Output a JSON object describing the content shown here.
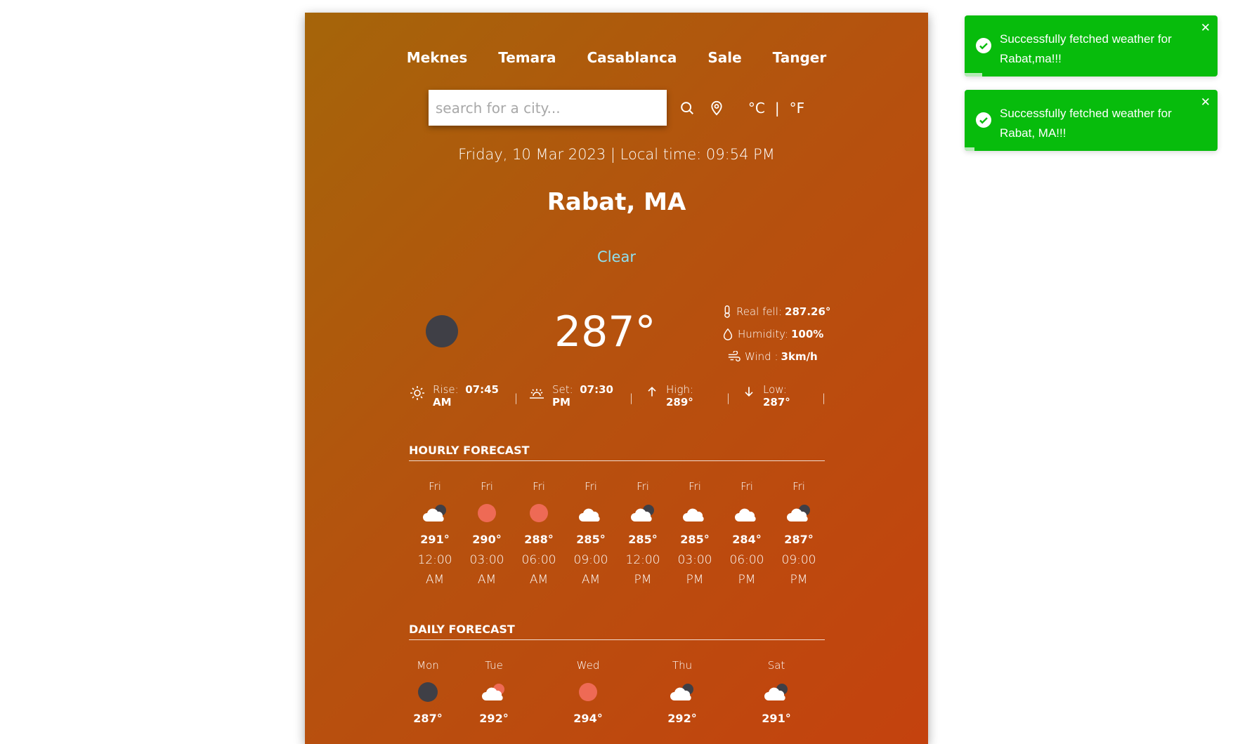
{
  "nav": {
    "cities": [
      "Meknes",
      "Temara",
      "Casablanca",
      "Sale",
      "Tanger"
    ]
  },
  "search": {
    "placeholder": "search for a city...",
    "value": ""
  },
  "units": {
    "celsius": "°C",
    "separator": "|",
    "fahrenheit": "°F"
  },
  "header": {
    "datetime": "Friday, 10 Mar 2023 | Local time: 09:54 PM",
    "city": "Rabat, MA",
    "condition": "Clear"
  },
  "current": {
    "temperature": "287°",
    "icon": "night-clear-icon",
    "real_feel_label": "Real fell:",
    "real_feel_value": "287.26°",
    "humidity_label": "Humidity:",
    "humidity_value": "100%",
    "wind_label": "Wind :",
    "wind_value": "3km/h"
  },
  "sun": {
    "rise_label": "Rise:",
    "rise_value": "07:45",
    "rise_ampm": "AM",
    "set_label": "Set:",
    "set_value": "07:30",
    "set_ampm": "PM",
    "high_label": "High:",
    "high_value": "289°",
    "low_label": "Low:",
    "low_value": "287°",
    "separator": "|"
  },
  "hourly": {
    "title": "HOURLY FORECAST",
    "items": [
      {
        "day": "Fri",
        "icon": "cloudy-night-icon",
        "temp": "291°",
        "time": "12:00",
        "ampm": "AM"
      },
      {
        "day": "Fri",
        "icon": "sun-icon",
        "temp": "290°",
        "time": "03:00",
        "ampm": "AM"
      },
      {
        "day": "Fri",
        "icon": "sun-icon",
        "temp": "288°",
        "time": "06:00",
        "ampm": "AM"
      },
      {
        "day": "Fri",
        "icon": "cloud-icon",
        "temp": "285°",
        "time": "09:00",
        "ampm": "AM"
      },
      {
        "day": "Fri",
        "icon": "cloudy-night-icon",
        "temp": "285°",
        "time": "12:00",
        "ampm": "PM"
      },
      {
        "day": "Fri",
        "icon": "cloud-icon",
        "temp": "285°",
        "time": "03:00",
        "ampm": "PM"
      },
      {
        "day": "Fri",
        "icon": "cloud-icon",
        "temp": "284°",
        "time": "06:00",
        "ampm": "PM"
      },
      {
        "day": "Fri",
        "icon": "cloudy-night-icon",
        "temp": "287°",
        "time": "09:00",
        "ampm": "PM"
      }
    ]
  },
  "daily": {
    "title": "DAILY FORECAST",
    "items": [
      {
        "day": "Mon",
        "icon": "night-clear-icon",
        "temp": "287°"
      },
      {
        "day": "Tue",
        "icon": "partly-cloudy-day-icon",
        "temp": "292°"
      },
      {
        "day": "Wed",
        "icon": "sun-icon",
        "temp": "294°"
      },
      {
        "day": "Thu",
        "icon": "cloudy-night-icon",
        "temp": "292°"
      },
      {
        "day": "Sat",
        "icon": "cloudy-night-icon",
        "temp": "291°"
      }
    ]
  },
  "toasts": [
    {
      "message": "Successfully fetched weather for Rabat,ma!!!",
      "close": "✕",
      "progress": 0.07
    },
    {
      "message": "Successfully fetched weather for Rabat, MA!!!",
      "close": "✕",
      "progress": 0.04
    }
  ],
  "colors": {
    "toast_bg": "#07bc0c",
    "sun": "#ee6a55",
    "moon": "#3f3f46",
    "condition": "#8fe0f0"
  }
}
